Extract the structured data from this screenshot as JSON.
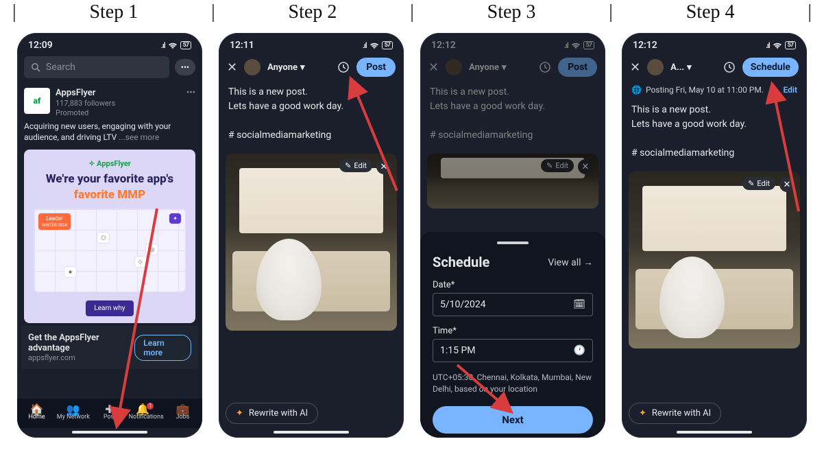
{
  "header": {
    "steps": [
      "Step 1",
      "Step 2",
      "Step 3",
      "Step 4"
    ]
  },
  "status": {
    "t1": "12:09",
    "t2": "12:11",
    "t3": "12:12",
    "t4": "12:12",
    "signal": "..ıl",
    "wifi": "🜄",
    "batt": "57"
  },
  "phone1": {
    "search_placeholder": "Search",
    "promoter": {
      "name": "AppsFlyer",
      "followers": "117,883 followers",
      "tag": "Promoted"
    },
    "promo_body": "Acquiring new users, engaging with your audience, and driving LTV",
    "see_more": "...see more",
    "ad": {
      "brand": "AppsFlyer",
      "headline": "We're your favorite app's",
      "sub": "favorite MMP",
      "cta": "Learn why"
    },
    "footer": {
      "title": "Get the AppsFlyer advantage",
      "domain": "appsflyer.com",
      "cta": "Learn more"
    },
    "nav": {
      "home": "Home",
      "network": "My Network",
      "post": "Post",
      "notif": "Notifications",
      "notif_count": "1",
      "jobs": "Jobs"
    }
  },
  "compose": {
    "audience": "Anyone",
    "audience_short": "A...",
    "post": "Post",
    "schedule": "Schedule",
    "body": "This is a new post.\nLets have a good work day.\n\n# socialmediamarketing",
    "edit": "Edit",
    "rewrite": "Rewrite with AI"
  },
  "schedule_sheet": {
    "title": "Schedule",
    "view_all": "View all →",
    "date_label": "Date*",
    "date_value": "5/10/2024",
    "time_label": "Time*",
    "time_value": "1:15 PM",
    "tz": "UTC+05:30, Chennai, Kolkata, Mumbai, New Delhi, based on your location",
    "next": "Next"
  },
  "scheduled_banner": {
    "text": "Posting Fri, May 10 at 11:00 PM.",
    "edit": "Edit"
  }
}
